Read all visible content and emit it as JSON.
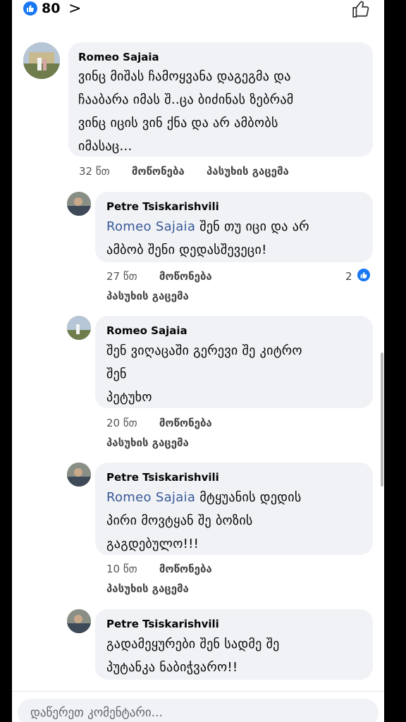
{
  "header": {
    "reaction_count": "80",
    "chevron": ">"
  },
  "comments": [
    {
      "name": "Romeo Sajaia",
      "mention": "",
      "lines": [
        "ვინც მიშას ჩამოყვანა დაგეგმა და",
        "ჩააბარა იმას შ..ცა ბიძინას ზებრამ",
        "ვინც იცის ვინ ქნა  და არ ამბობს",
        "იმასაც..."
      ],
      "time": "32 წთ",
      "like": "მოწონება",
      "reply": "პასუხის გაცემა"
    },
    {
      "name": "Petre Tsiskarishvili",
      "mention": "Romeo Sajaia",
      "lines": [
        "შენ თუ იცი და არ",
        "ამბობ შენი დედასშევეცი!"
      ],
      "time": "27 წთ",
      "like": "მოწონება",
      "reply": "პასუხის გაცემა",
      "likes": "2"
    },
    {
      "name": "Romeo Sajaia",
      "mention": "",
      "lines": [
        "შენ ვიღაცაში გერევი შე კიტრო",
        "შენ",
        "პეტუხო"
      ],
      "time": "20 წთ",
      "like": "მოწონება",
      "reply": "პასუხის გაცემა"
    },
    {
      "name": "Petre Tsiskarishvili",
      "mention": "Romeo Sajaia",
      "lines": [
        "მტყუანის დედის",
        "პირი მოვტყან შე ბოზის",
        "გაგდებულო!!!"
      ],
      "time": "10 წთ",
      "like": "მოწონება",
      "reply": "პასუხის გაცემა"
    },
    {
      "name": "Petre Tsiskarishvili",
      "mention": "",
      "lines": [
        "გადამეყურები შენ სადმე შე",
        "პუტანკა ნაბიჭვარო!!"
      ]
    }
  ],
  "composer": {
    "placeholder": "დაწერეთ კომენტარი..."
  },
  "icons": {
    "reaction": "thumbs-up-icon",
    "like_outline": "thumbs-up-outline-icon",
    "chevron": "chevron-right-icon"
  },
  "colors": {
    "accent": "#1877f2",
    "mention": "#385898",
    "bubble": "#f0f2f5"
  }
}
